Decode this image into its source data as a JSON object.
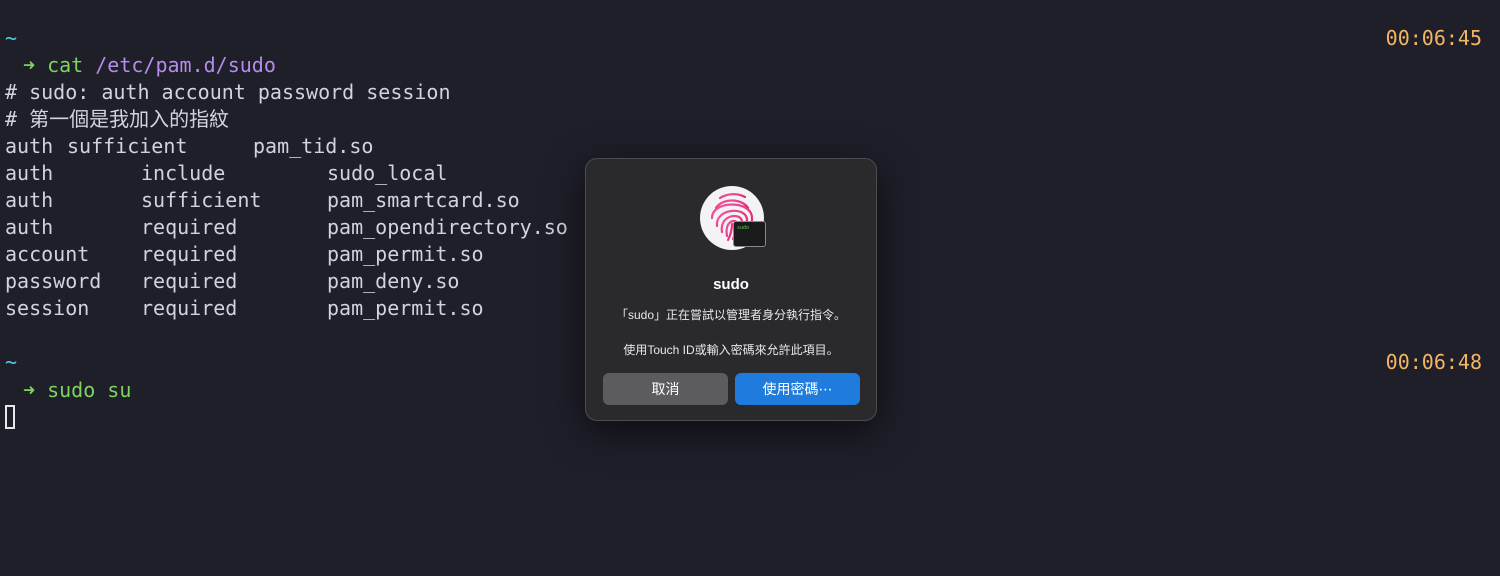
{
  "terminal": {
    "prompt_tilde": "~",
    "prompt_apple": "",
    "prompt_arrow": "➜",
    "block1": {
      "timestamp": "00:06:45",
      "command": "cat",
      "command_arg": "/etc/pam.d/sudo",
      "comment1": "# sudo: auth account password session",
      "comment2": "# 第一個是我加入的指紋",
      "first_rule": {
        "type": "auth",
        "control": "sufficient",
        "module": "pam_tid.so"
      },
      "rules": [
        {
          "type": "auth",
          "control": "include",
          "module": "sudo_local"
        },
        {
          "type": "auth",
          "control": "sufficient",
          "module": "pam_smartcard.so"
        },
        {
          "type": "auth",
          "control": "required",
          "module": "pam_opendirectory.so"
        },
        {
          "type": "account",
          "control": "required",
          "module": "pam_permit.so"
        },
        {
          "type": "password",
          "control": "required",
          "module": "pam_deny.so"
        },
        {
          "type": "session",
          "control": "required",
          "module": "pam_permit.so"
        }
      ]
    },
    "block2": {
      "timestamp": "00:06:48",
      "command": "sudo su"
    }
  },
  "dialog": {
    "title": "sudo",
    "message": "「sudo」正在嘗試以管理者身分執行指令。",
    "hint": "使用Touch ID或輸入密碼來允許此項目。",
    "badge_text": "sudo",
    "cancel_label": "取消",
    "password_label": "使用密碼⋯",
    "colors": {
      "accent": "#1f7bdc",
      "fingerprint": "#e83a8a"
    }
  }
}
